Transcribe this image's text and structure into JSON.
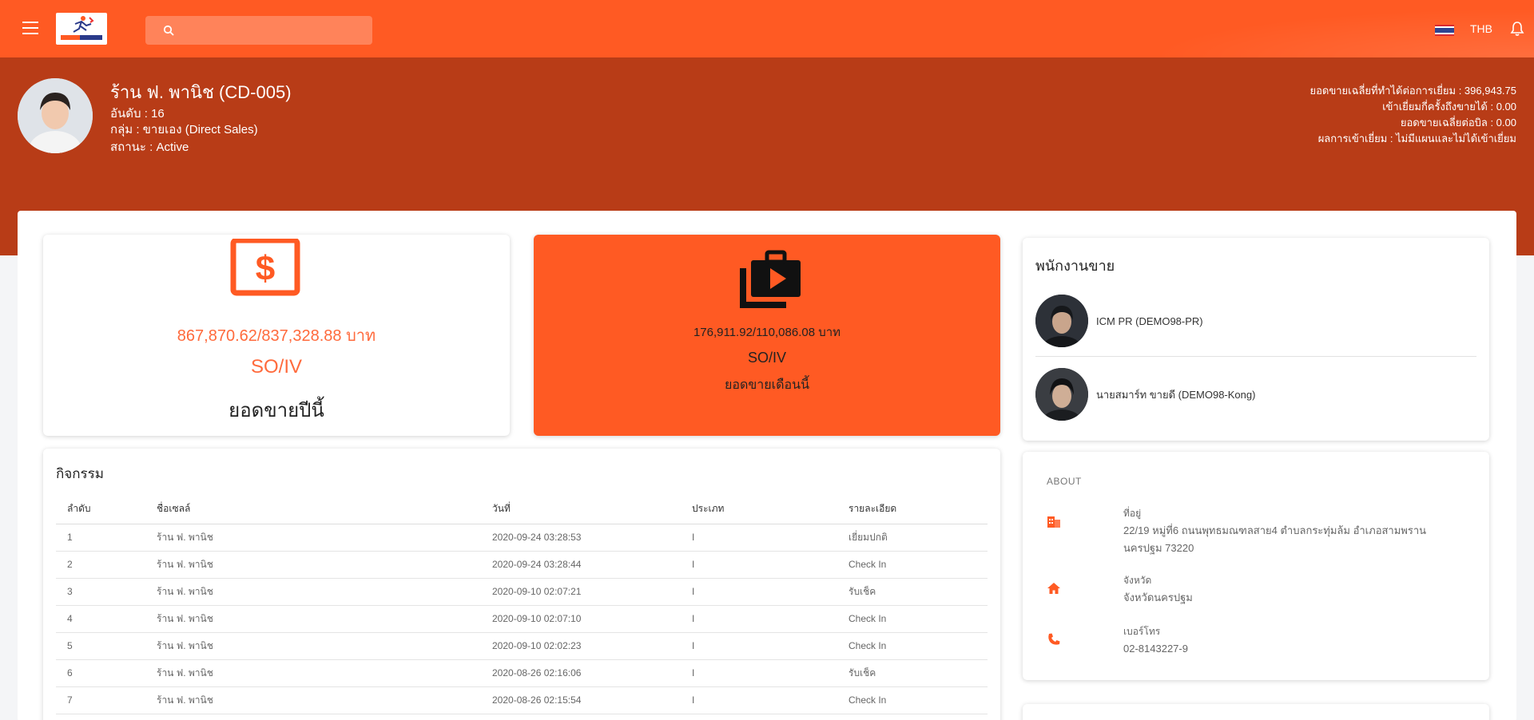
{
  "topbar": {
    "search_placeholder": "",
    "currency": "THB"
  },
  "store": {
    "name": "ร้าน ฟ. พานิช (CD-005)",
    "rank": "อันดับ : 16",
    "group": "กลุ่ม : ขายเอง (Direct Sales)",
    "status": "สถานะ : Active"
  },
  "stats": [
    "ยอดขายเฉลี่ยที่ทำได้ต่อการเยี่ยม : 396,943.75",
    "เข้าเยี่ยมกี่ครั้งถึงขายได้ : 0.00",
    "ยอดขายเฉลี่ยต่อบิล : 0.00",
    "ผลการเข้าเยี่ยม : ไม่มีแผนและไม่ได้เข้าเยี่ยม"
  ],
  "year_card": {
    "amount": "867,870.62/837,328.88 บาท",
    "type": "SO/IV",
    "label": "ยอดขายปีนี้"
  },
  "month_card": {
    "amount": "176,911.92/110,086.08 บาท",
    "type": "SO/IV",
    "label": "ยอดขายเดือนนี้"
  },
  "salespeople": {
    "title": "พนักงานขาย",
    "people": [
      {
        "name": "ICM PR (DEMO98-PR)"
      },
      {
        "name": "นายสมาร์ท ขายดี (DEMO98-Kong)"
      }
    ]
  },
  "about": {
    "title": "ABOUT",
    "address_label": "ที่อยู่",
    "address_value": "22/19 หมู่ที่6 ถนนพุทธมณฑลสาย4 ตำบลกระทุ่มล้ม อำเภอสามพราน นครปฐม 73220",
    "province_label": "จังหวัด",
    "province_value": "จังหวัดนครปฐม",
    "phone_label": "เบอร์โทร",
    "phone_value": "02-8143227-9"
  },
  "activity": {
    "title": "กิจกรรม",
    "headers": [
      "ลำดับ",
      "ชื่อเซลล์",
      "วันที่",
      "ประเภท",
      "รายละเอียด"
    ],
    "rows": [
      [
        "1",
        "ร้าน ฟ. พานิช",
        "2020-09-24 03:28:53",
        "I",
        "เยี่ยมปกติ"
      ],
      [
        "2",
        "ร้าน ฟ. พานิช",
        "2020-09-24 03:28:44",
        "I",
        "Check In"
      ],
      [
        "3",
        "ร้าน ฟ. พานิช",
        "2020-09-10 02:07:21",
        "I",
        "รับเช็ค"
      ],
      [
        "4",
        "ร้าน ฟ. พานิช",
        "2020-09-10 02:07:10",
        "I",
        "Check In"
      ],
      [
        "5",
        "ร้าน ฟ. พานิช",
        "2020-09-10 02:02:23",
        "I",
        "Check In"
      ],
      [
        "6",
        "ร้าน ฟ. พานิช",
        "2020-08-26 02:16:06",
        "I",
        "รับเช็ค"
      ],
      [
        "7",
        "ร้าน ฟ. พานิช",
        "2020-08-26 02:15:54",
        "I",
        "Check In"
      ]
    ]
  },
  "colors": {
    "primary": "#ff5a23",
    "banner": "#b83c17",
    "accent_text": "#ff6a3c"
  },
  "icons": {
    "menu": "menu-icon",
    "search": "search-icon",
    "flag": "thai-flag-icon",
    "notification": "bell-icon",
    "sales_year": "dollar-icon",
    "sales_month": "video-library-icon",
    "address": "building-icon",
    "province": "home-icon",
    "phone": "phone-icon"
  }
}
